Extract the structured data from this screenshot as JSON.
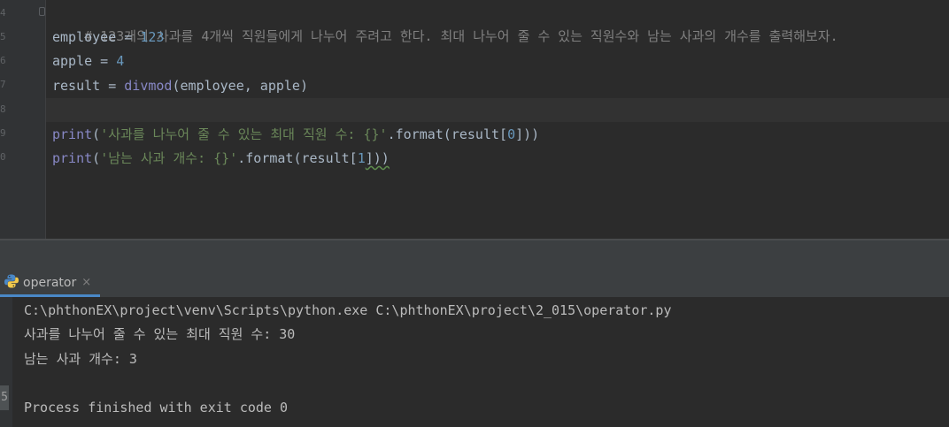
{
  "editor": {
    "line_numbers": [
      "4",
      "5",
      "6",
      "7",
      "8",
      "9",
      "0"
    ],
    "comment": "# 123개의 사과를 4개씩 직원들에게 나누어 주려고 한다. 최대 나누어 줄 수 있는 직원수와 남는 사과의 개수를 출력해보자.",
    "line2": {
      "var": "employee",
      "op": " = ",
      "num": "123"
    },
    "line3": {
      "var": "apple",
      "op": " = ",
      "num": "4"
    },
    "line4": {
      "var": "result",
      "op": " = ",
      "fn": "divmod",
      "args": "(employee, apple)"
    },
    "line6": {
      "fn": "print",
      "open": "(",
      "str": "'사과를 나누어 줄 수 있는 최대 직원 수: {}'",
      "mid": ".format(result[",
      "idx": "0",
      "close": "]))"
    },
    "line7": {
      "fn": "print",
      "open": "(",
      "str": "'남는 사과 개수: {}'",
      "mid": ".format(result[",
      "idx": "1",
      "close": "]))"
    }
  },
  "run_panel": {
    "tab_label": "operator",
    "close_glyph": "×",
    "gutter_mark": "5",
    "output": [
      "C:\\phthonEX\\project\\venv\\Scripts\\python.exe C:\\phthonEX\\project\\2_015\\operator.py",
      "사과를 나누어 줄 수 있는 최대 직원 수: 30",
      "남는 사과 개수: 3",
      "",
      "Process finished with exit code 0"
    ]
  },
  "colors": {
    "background": "#2b2b2b",
    "comment": "#808080",
    "number": "#6897bb",
    "string": "#6a8759",
    "builtin": "#8888c6",
    "text": "#a9b7c6",
    "tab_underline": "#4a88c7"
  },
  "icons": {
    "run_tab": "python-icon"
  }
}
